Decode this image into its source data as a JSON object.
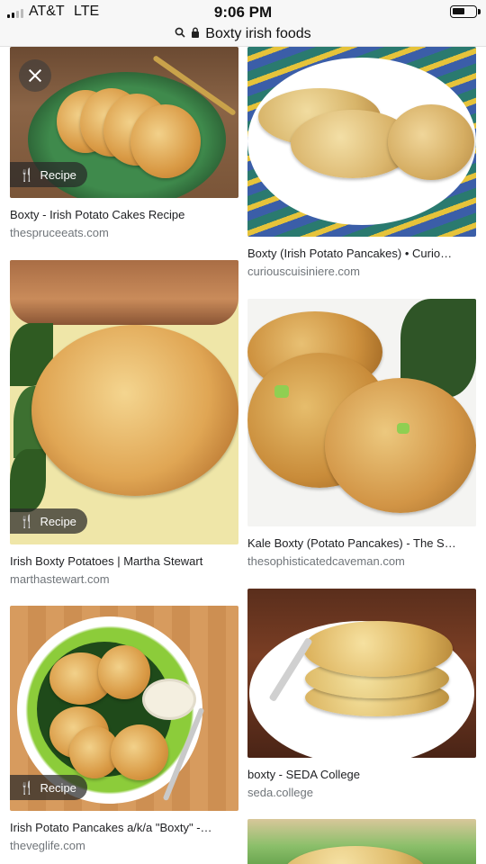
{
  "status_bar": {
    "carrier": "AT&T",
    "network": "LTE",
    "time": "9:06 PM",
    "battery_level": 0.55
  },
  "url_bar": {
    "lock_icon": "lock-icon",
    "search_icon": "search-icon",
    "text": "Boxty irish foods"
  },
  "badge_label": "Recipe",
  "results": [
    {
      "title": "Boxty - Irish Potato Cakes Recipe",
      "domain": "thespruceeats.com",
      "recipe": true
    },
    {
      "title": "Boxty (Irish Potato Pancakes) • Curio…",
      "domain": "curiouscuisiniere.com",
      "recipe": false
    },
    {
      "title": "Irish Boxty Potatoes | Martha Stewart",
      "domain": "marthastewart.com",
      "recipe": true
    },
    {
      "title": "Kale Boxty (Potato Pancakes) - The S…",
      "domain": "thesophisticatedcaveman.com",
      "recipe": false
    },
    {
      "title": "Irish Potato Pancakes a/k/a \"Boxty\" -…",
      "domain": "theveglife.com",
      "recipe": true
    },
    {
      "title": "boxty - SEDA College",
      "domain": "seda.college",
      "recipe": false
    }
  ],
  "colors": {
    "title_text": "#202124",
    "domain_text": "#70757a",
    "badge_bg": "#282828"
  }
}
